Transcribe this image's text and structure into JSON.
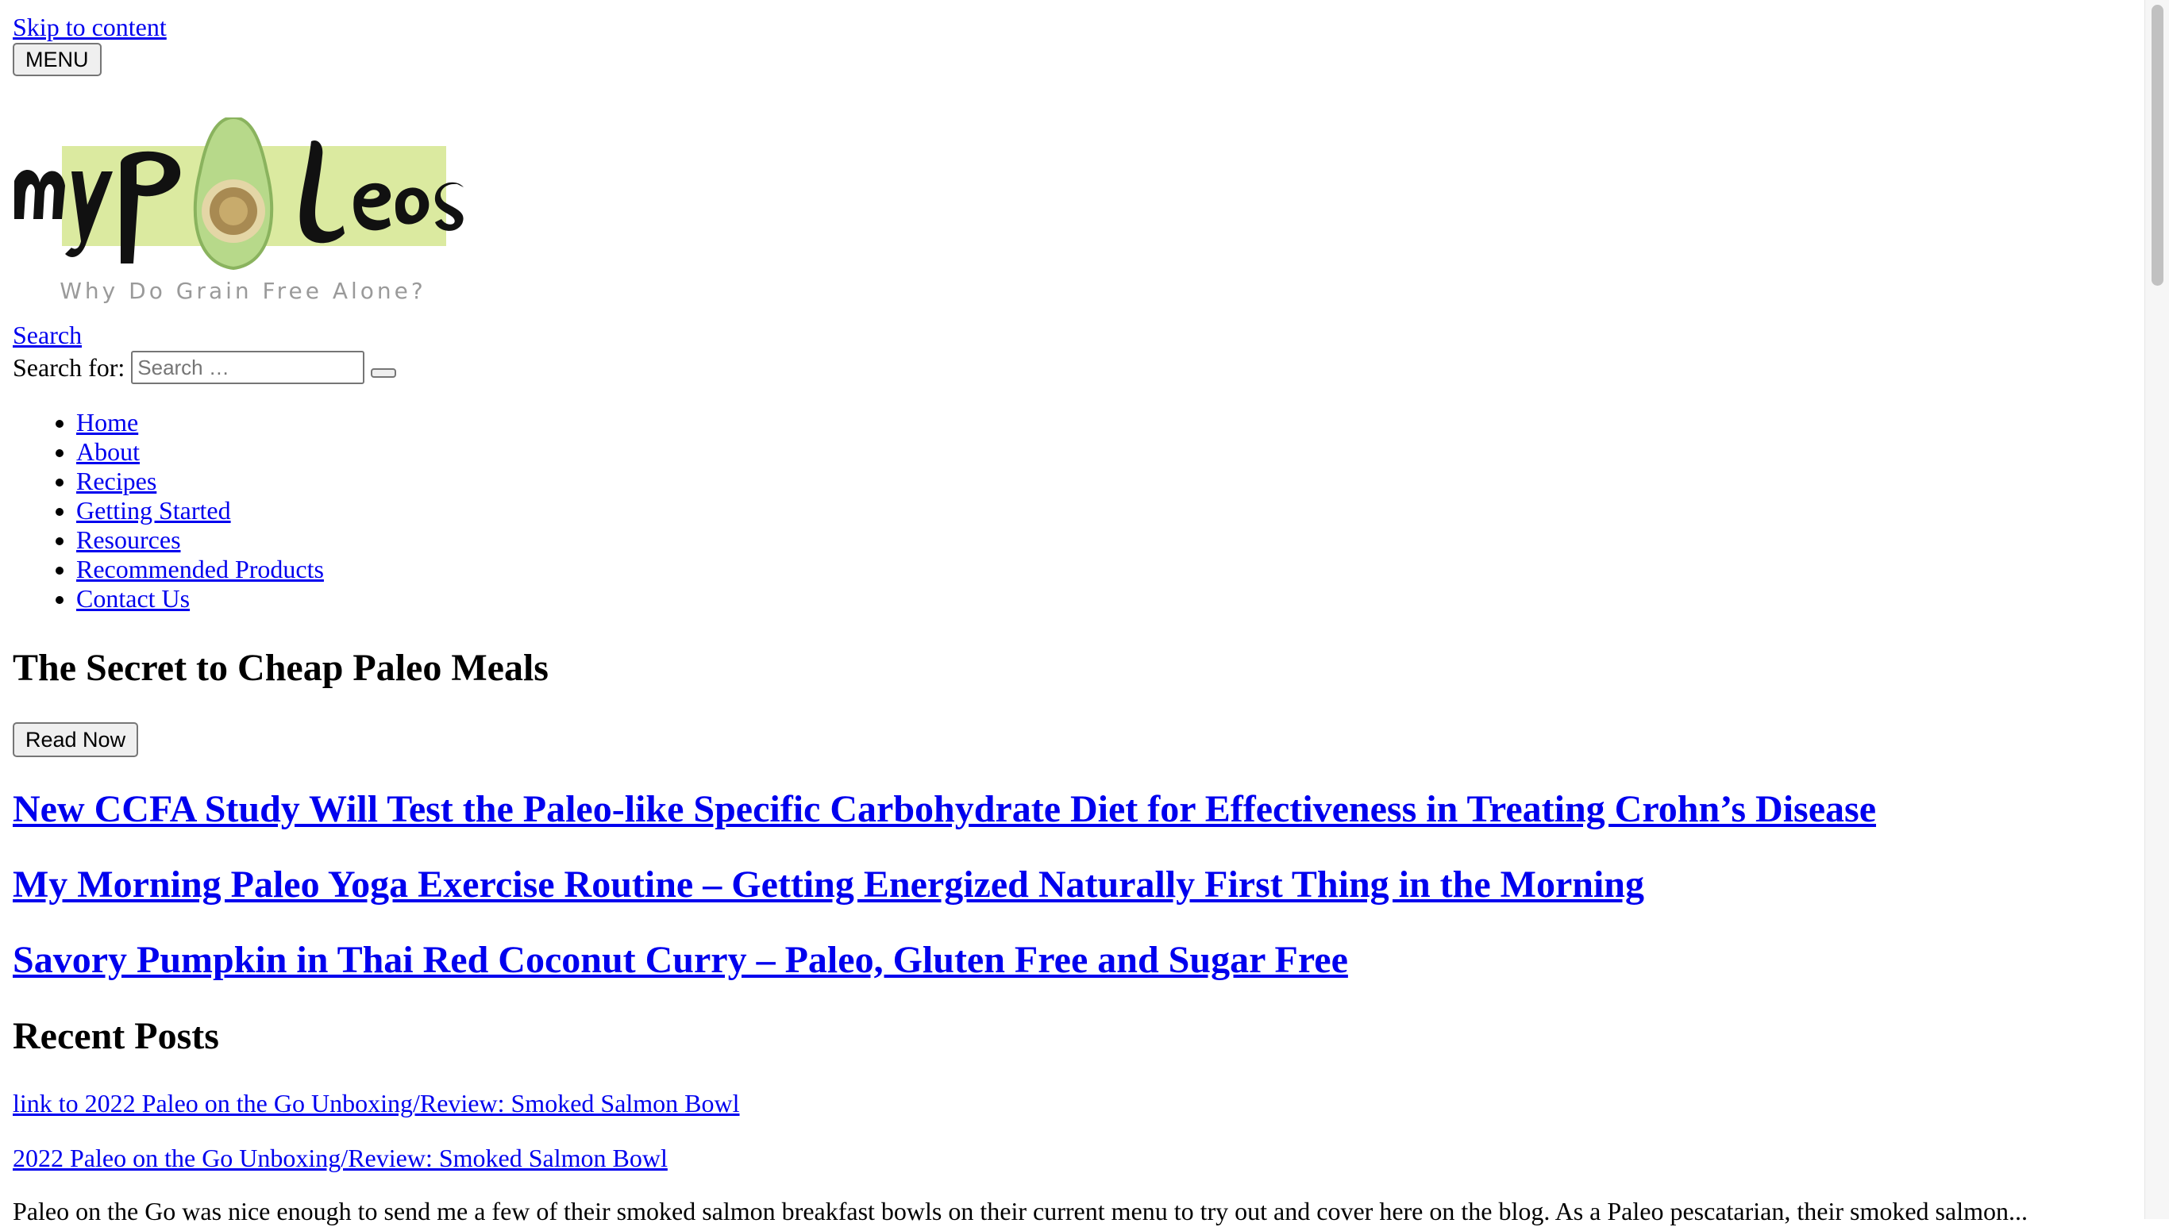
{
  "skip_link": "Skip to content",
  "menu_button": "MENU",
  "logo": {
    "wordmark": "myPaLeos",
    "tagline": "Why Do Grain Free Alone?",
    "colors": {
      "highlight": "#dbeaa0",
      "avocado_skin": "#b7d98a",
      "avocado_pit": "#a88a52",
      "text": "#111111",
      "tagline": "#9a9a9a"
    }
  },
  "search": {
    "link": "Search",
    "label": "Search for:",
    "placeholder": "Search …",
    "submit_icon": "search-submit-button"
  },
  "nav": {
    "items": [
      {
        "label": "Home"
      },
      {
        "label": "About"
      },
      {
        "label": "Recipes"
      },
      {
        "label": "Getting Started"
      },
      {
        "label": "Resources"
      },
      {
        "label": "Recommended Products"
      },
      {
        "label": "Contact Us"
      }
    ]
  },
  "featured": {
    "title": "The Secret to Cheap Paleo Meals",
    "button": "Read Now"
  },
  "posts": [
    {
      "title": "New CCFA Study Will Test the Paleo-like Specific Carbohydrate Diet for Effectiveness in Treating Crohn’s Disease"
    },
    {
      "title": "My Morning Paleo Yoga Exercise Routine – Getting Energized Naturally First Thing in the Morning"
    },
    {
      "title": "Savory Pumpkin in Thai Red Coconut Curry – Paleo, Gluten Free and Sugar Free"
    }
  ],
  "recent": {
    "heading": "Recent Posts",
    "links": [
      {
        "label": "link to 2022 Paleo on the Go Unboxing/Review: Smoked Salmon Bowl"
      },
      {
        "label": "2022 Paleo on the Go Unboxing/Review: Smoked Salmon Bowl"
      }
    ],
    "excerpt": "Paleo on the Go was nice enough to send me a few of their smoked salmon breakfast bowls on their current menu to try out and cover here on the blog. As a Paleo pescatarian, their smoked salmon..."
  },
  "colors": {
    "link": "#0000ee",
    "text": "#000000"
  }
}
